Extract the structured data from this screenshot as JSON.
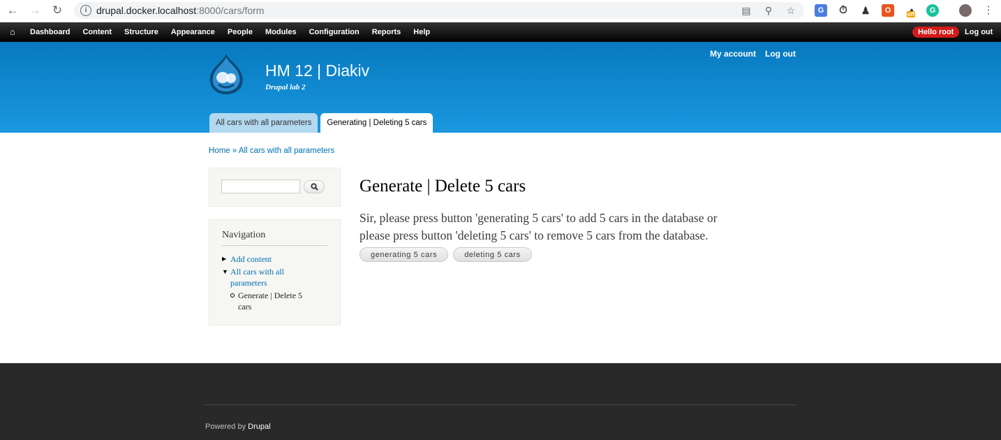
{
  "browser": {
    "url_host": "drupal.docker.localhost",
    "url_path": ":8000/cars/form",
    "extension_badge": "off"
  },
  "toolbar": {
    "menu": [
      "Dashboard",
      "Content",
      "Structure",
      "Appearance",
      "People",
      "Modules",
      "Configuration",
      "Reports",
      "Help"
    ],
    "hello": "Hello root",
    "logout": "Log out"
  },
  "header": {
    "site_name": "HM 12 | Diakiv",
    "slogan": "Drupal lab 2",
    "secondary": [
      "My account",
      "Log out"
    ],
    "tabs": [
      "All cars with all parameters",
      "Generating | Deleting 5 cars"
    ],
    "active_tab": 1
  },
  "breadcrumb": {
    "home": "Home",
    "separator": "»",
    "current": "All cars with all parameters"
  },
  "navigation": {
    "title": "Navigation",
    "add_content": "Add content",
    "all_cars_line1": "All cars with all",
    "all_cars_line2": "parameters",
    "generate_line1": "Generate | Delete 5",
    "generate_line2": "cars"
  },
  "main": {
    "title": "Generate | Delete 5 cars",
    "intro_line1": "Sir, please press button 'generating 5 cars' to add 5 cars in the database or",
    "intro_line2": "please press button 'deleting 5 cars' to remove 5 cars from the database.",
    "generate_button": "generating 5 cars",
    "delete_button": "deleting 5 cars"
  },
  "footer": {
    "powered_by": "Powered by",
    "drupal": "Drupal"
  },
  "colors": {
    "header_top": "#0779bf",
    "header_bottom": "#1a98e0",
    "link": "#0071b3",
    "footer": "#292929",
    "hello_badge": "#d21a1a"
  }
}
